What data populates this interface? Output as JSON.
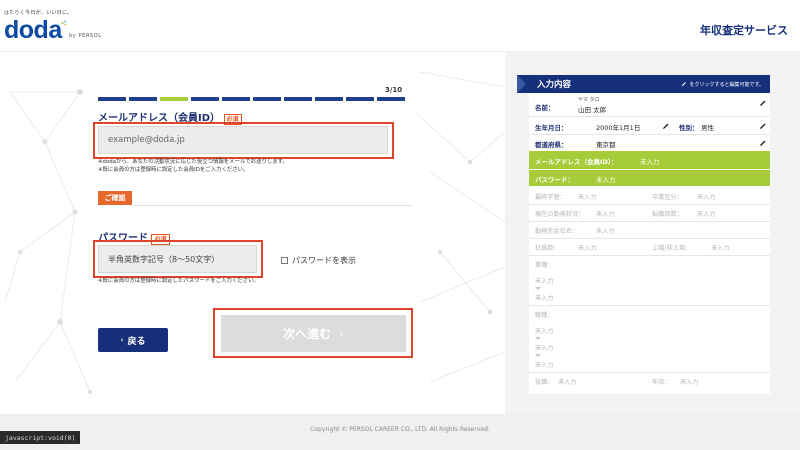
{
  "header": {
    "tagline": "はたらく今日が、いい日に。",
    "logo": "doda",
    "logo_by": "by PERSOL",
    "service_title": "年収査定サービス"
  },
  "progress": {
    "step": "3/10",
    "current": 3,
    "total": 10
  },
  "email": {
    "label": "メールアドレス（会員ID）",
    "required": "必須",
    "placeholder": "example@doda.jp",
    "note1": "※dodaから、あなたの活動状況に応じた役立つ情報をメールでお送りします。",
    "note2": "※既に会員の方は登録時に設定した会員IDをご入力ください。"
  },
  "confirm_badge": "ご確認",
  "password": {
    "label": "パスワード",
    "required": "必須",
    "placeholder": "半角英数字記号（8～50文字）",
    "show_label": "パスワードを表示",
    "note": "※既に会員の方は登録時に設定したパスワードをご入力ください。"
  },
  "buttons": {
    "back": "戻る",
    "next": "次へ進む"
  },
  "panel": {
    "title": "入力内容",
    "hint": "をクリックすると編集可能です。",
    "name_label": "名前：",
    "name_kana": "ヤマ タロ",
    "name_value": "山田 太郎",
    "birth_label": "生年月日：",
    "birth_value": "2000年1月1日",
    "gender_label": "性別：",
    "gender_value": "男性",
    "pref_label": "都道府県：",
    "pref_value": "東京都",
    "email_label": "メールアドレス（会員ID）：",
    "email_value": "未入力",
    "pass_label": "パスワード：",
    "pass_value": "未入力",
    "edu_label": "最終学歴：",
    "edu_value": "未入力",
    "grad_label": "卒業区分：",
    "grad_value": "未入力",
    "status_label": "現在の勤務状況：",
    "status_value": "未入力",
    "jobchange_label": "転職回数：",
    "jobchange_value": "未入力",
    "company_label": "勤務先会社名：",
    "company_value": "未入力",
    "employees_label": "社員数：",
    "employees_value": "未入力",
    "listing_label": "上場/非上場：",
    "listing_value": "未入力",
    "industry_label": "業種：",
    "industry_values": [
      "未入力",
      "未入力"
    ],
    "occupation_label": "職種：",
    "occupation_values": [
      "未入力",
      "未入力",
      "未入力"
    ],
    "position_label": "役職：",
    "position_value": "未入力",
    "income_label": "年収：",
    "income_value": "未入力"
  },
  "footer": {
    "copyright": "Copyright © PERSOL CAREER CO., LTD. All Rights Reserved."
  },
  "status_bar": "javascript:void(0)",
  "colors": {
    "navy": "#17307c",
    "green": "#a6cc3a",
    "orange": "#e6682b",
    "red_frame": "#e0452b",
    "progress_done": "#1f3f8f",
    "progress_current": "#a6cc3a"
  },
  "icons": [
    "pencil-icon",
    "chevron-left-icon",
    "chevron-right-icon",
    "checkbox-icon"
  ]
}
